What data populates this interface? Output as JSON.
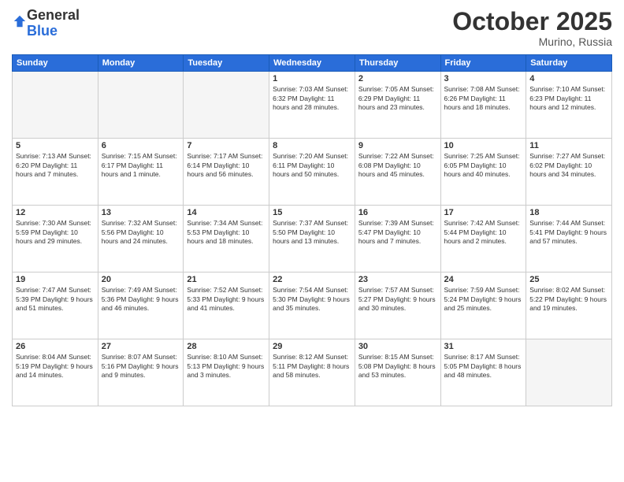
{
  "header": {
    "logo_line1": "General",
    "logo_line2": "Blue",
    "month": "October 2025",
    "location": "Murino, Russia"
  },
  "weekdays": [
    "Sunday",
    "Monday",
    "Tuesday",
    "Wednesday",
    "Thursday",
    "Friday",
    "Saturday"
  ],
  "weeks": [
    [
      {
        "day": "",
        "info": ""
      },
      {
        "day": "",
        "info": ""
      },
      {
        "day": "",
        "info": ""
      },
      {
        "day": "1",
        "info": "Sunrise: 7:03 AM\nSunset: 6:32 PM\nDaylight: 11 hours\nand 28 minutes."
      },
      {
        "day": "2",
        "info": "Sunrise: 7:05 AM\nSunset: 6:29 PM\nDaylight: 11 hours\nand 23 minutes."
      },
      {
        "day": "3",
        "info": "Sunrise: 7:08 AM\nSunset: 6:26 PM\nDaylight: 11 hours\nand 18 minutes."
      },
      {
        "day": "4",
        "info": "Sunrise: 7:10 AM\nSunset: 6:23 PM\nDaylight: 11 hours\nand 12 minutes."
      }
    ],
    [
      {
        "day": "5",
        "info": "Sunrise: 7:13 AM\nSunset: 6:20 PM\nDaylight: 11 hours\nand 7 minutes."
      },
      {
        "day": "6",
        "info": "Sunrise: 7:15 AM\nSunset: 6:17 PM\nDaylight: 11 hours\nand 1 minute."
      },
      {
        "day": "7",
        "info": "Sunrise: 7:17 AM\nSunset: 6:14 PM\nDaylight: 10 hours\nand 56 minutes."
      },
      {
        "day": "8",
        "info": "Sunrise: 7:20 AM\nSunset: 6:11 PM\nDaylight: 10 hours\nand 50 minutes."
      },
      {
        "day": "9",
        "info": "Sunrise: 7:22 AM\nSunset: 6:08 PM\nDaylight: 10 hours\nand 45 minutes."
      },
      {
        "day": "10",
        "info": "Sunrise: 7:25 AM\nSunset: 6:05 PM\nDaylight: 10 hours\nand 40 minutes."
      },
      {
        "day": "11",
        "info": "Sunrise: 7:27 AM\nSunset: 6:02 PM\nDaylight: 10 hours\nand 34 minutes."
      }
    ],
    [
      {
        "day": "12",
        "info": "Sunrise: 7:30 AM\nSunset: 5:59 PM\nDaylight: 10 hours\nand 29 minutes."
      },
      {
        "day": "13",
        "info": "Sunrise: 7:32 AM\nSunset: 5:56 PM\nDaylight: 10 hours\nand 24 minutes."
      },
      {
        "day": "14",
        "info": "Sunrise: 7:34 AM\nSunset: 5:53 PM\nDaylight: 10 hours\nand 18 minutes."
      },
      {
        "day": "15",
        "info": "Sunrise: 7:37 AM\nSunset: 5:50 PM\nDaylight: 10 hours\nand 13 minutes."
      },
      {
        "day": "16",
        "info": "Sunrise: 7:39 AM\nSunset: 5:47 PM\nDaylight: 10 hours\nand 7 minutes."
      },
      {
        "day": "17",
        "info": "Sunrise: 7:42 AM\nSunset: 5:44 PM\nDaylight: 10 hours\nand 2 minutes."
      },
      {
        "day": "18",
        "info": "Sunrise: 7:44 AM\nSunset: 5:41 PM\nDaylight: 9 hours\nand 57 minutes."
      }
    ],
    [
      {
        "day": "19",
        "info": "Sunrise: 7:47 AM\nSunset: 5:39 PM\nDaylight: 9 hours\nand 51 minutes."
      },
      {
        "day": "20",
        "info": "Sunrise: 7:49 AM\nSunset: 5:36 PM\nDaylight: 9 hours\nand 46 minutes."
      },
      {
        "day": "21",
        "info": "Sunrise: 7:52 AM\nSunset: 5:33 PM\nDaylight: 9 hours\nand 41 minutes."
      },
      {
        "day": "22",
        "info": "Sunrise: 7:54 AM\nSunset: 5:30 PM\nDaylight: 9 hours\nand 35 minutes."
      },
      {
        "day": "23",
        "info": "Sunrise: 7:57 AM\nSunset: 5:27 PM\nDaylight: 9 hours\nand 30 minutes."
      },
      {
        "day": "24",
        "info": "Sunrise: 7:59 AM\nSunset: 5:24 PM\nDaylight: 9 hours\nand 25 minutes."
      },
      {
        "day": "25",
        "info": "Sunrise: 8:02 AM\nSunset: 5:22 PM\nDaylight: 9 hours\nand 19 minutes."
      }
    ],
    [
      {
        "day": "26",
        "info": "Sunrise: 8:04 AM\nSunset: 5:19 PM\nDaylight: 9 hours\nand 14 minutes."
      },
      {
        "day": "27",
        "info": "Sunrise: 8:07 AM\nSunset: 5:16 PM\nDaylight: 9 hours\nand 9 minutes."
      },
      {
        "day": "28",
        "info": "Sunrise: 8:10 AM\nSunset: 5:13 PM\nDaylight: 9 hours\nand 3 minutes."
      },
      {
        "day": "29",
        "info": "Sunrise: 8:12 AM\nSunset: 5:11 PM\nDaylight: 8 hours\nand 58 minutes."
      },
      {
        "day": "30",
        "info": "Sunrise: 8:15 AM\nSunset: 5:08 PM\nDaylight: 8 hours\nand 53 minutes."
      },
      {
        "day": "31",
        "info": "Sunrise: 8:17 AM\nSunset: 5:05 PM\nDaylight: 8 hours\nand 48 minutes."
      },
      {
        "day": "",
        "info": ""
      }
    ]
  ]
}
